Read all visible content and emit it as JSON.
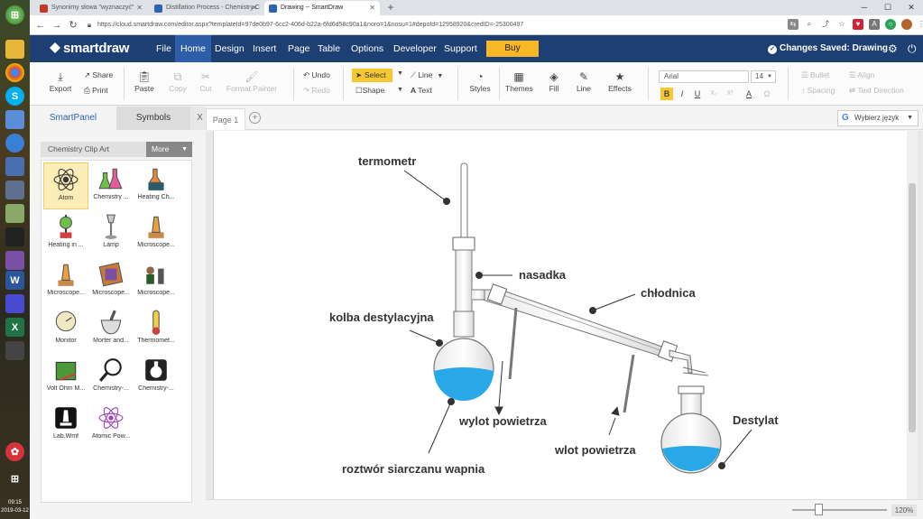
{
  "taskbar": {
    "clock_time": "09:15",
    "clock_date": "2019-03-12"
  },
  "browser": {
    "tabs": [
      {
        "label": "Synonimy słowa \"wyznaczyć\"",
        "active": false
      },
      {
        "label": "Distillation Process - Chemistry C",
        "active": false
      },
      {
        "label": "Drawing -- SmartDraw",
        "active": true
      }
    ],
    "url": "https://cloud.smartdraw.com/editor.aspx?templateId=97de0b97-6cc2-406d-b22a-6fd6d58c90a1&noro=1&nosu=1#depoId=12958920&credID=-25300497"
  },
  "app": {
    "logo": "smartdraw",
    "menu": [
      "File",
      "Home",
      "Design",
      "Insert",
      "Page",
      "Table",
      "Options",
      "Developer",
      "Support"
    ],
    "active_menu": "Home",
    "buy_label": "Buy",
    "saved_status": "Changes Saved: Drawing"
  },
  "ribbon": {
    "export": "Export",
    "share": "Share",
    "print": "Print",
    "paste": "Paste",
    "copy": "Copy",
    "cut": "Cut",
    "format_painter": "Format Painter",
    "undo": "Undo",
    "redo": "Redo",
    "select": "Select",
    "shape": "Shape",
    "line": "Line",
    "text": "Text",
    "styles": "Styles",
    "themes": "Themes",
    "fill": "Fill",
    "line2": "Line",
    "effects": "Effects",
    "font": "Arial",
    "font_size": "14",
    "bold": "B",
    "italic": "I",
    "underline": "U",
    "subscript": "X₂",
    "superscript": "X²",
    "font_color": "A",
    "symbol": "Ω",
    "bullet": "Bullet",
    "align": "Align",
    "spacing": "Spacing",
    "text_direction": "Text Direction"
  },
  "panel": {
    "tab_smartpanel": "SmartPanel",
    "tab_symbols": "Symbols",
    "close": "X",
    "library": "Chemistry Clip Art",
    "more": "More",
    "symbols": [
      {
        "label": "Atom",
        "icon": "atom-icon"
      },
      {
        "label": "Chemistry ...",
        "icon": "flasks-icon"
      },
      {
        "label": "Heating Ch...",
        "icon": "heating-chemicals-icon"
      },
      {
        "label": "Heating in ...",
        "icon": "heating-stand-icon"
      },
      {
        "label": "Lamp",
        "icon": "lamp-icon"
      },
      {
        "label": "Microscope...",
        "icon": "microscope-icon"
      },
      {
        "label": "Microscope...",
        "icon": "microscope-icon"
      },
      {
        "label": "Microscope...",
        "icon": "microscope-slide-icon"
      },
      {
        "label": "Microscope...",
        "icon": "microscope-user-icon"
      },
      {
        "label": "Monitor",
        "icon": "monitor-icon"
      },
      {
        "label": "Morter and...",
        "icon": "mortar-icon"
      },
      {
        "label": "Thermomet...",
        "icon": "thermometer-icon"
      },
      {
        "label": "Volt Ohm M...",
        "icon": "multimeter-icon"
      },
      {
        "label": "Chemistry-...",
        "icon": "magnifier-icon"
      },
      {
        "label": "Chemistry-...",
        "icon": "flask-dark-icon"
      },
      {
        "label": "Lab.Wmf",
        "icon": "lab-microscope-icon"
      },
      {
        "label": "Atomic Pow...",
        "icon": "atomic-power-icon"
      }
    ]
  },
  "pages": {
    "tab": "Page 1",
    "add": "+"
  },
  "language": {
    "label": "Wybierz język"
  },
  "diagram": {
    "labels": {
      "termometr": "termometr",
      "nasadka": "nasadka",
      "chlodnica": "chłodnica",
      "kolba": "kolba destylacyjna",
      "wylot": "wylot powietrza",
      "wlot": "wlot powietrza",
      "destylat": "Destylat",
      "roztwor": "roztwór siarczanu wapnia"
    },
    "liquid_color": "#29a8e8"
  },
  "status": {
    "zoom": "120%"
  }
}
